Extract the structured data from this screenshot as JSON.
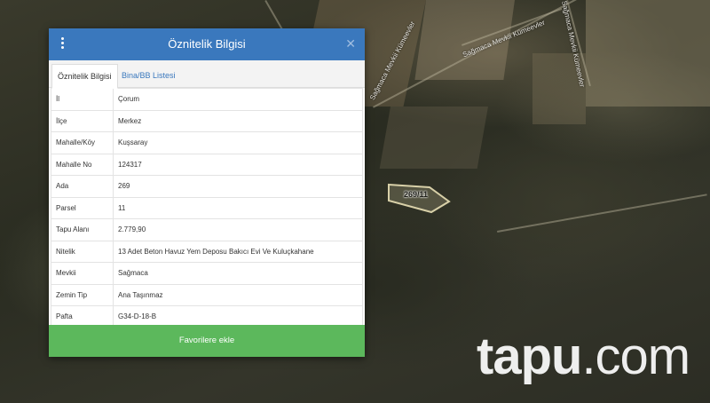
{
  "dialog": {
    "title": "Öznitelik Bilgisi",
    "tabs": [
      {
        "label": "Öznitelik Bilgisi",
        "active": true
      },
      {
        "label": "Bina/BB Listesi",
        "active": false
      }
    ],
    "rows": [
      {
        "key": "İl",
        "value": "Çorum"
      },
      {
        "key": "İlçe",
        "value": "Merkez"
      },
      {
        "key": "Mahalle/Köy",
        "value": "Kuşsaray"
      },
      {
        "key": "Mahalle No",
        "value": "124317"
      },
      {
        "key": "Ada",
        "value": "269"
      },
      {
        "key": "Parsel",
        "value": "11"
      },
      {
        "key": "Tapu Alanı",
        "value": "2.779,90"
      },
      {
        "key": "Nitelik",
        "value": "13 Adet Beton Havuz Yem Deposu Bakıcı Evi Ve Kuluçkahane"
      },
      {
        "key": "Mevkii",
        "value": "Sağmaca"
      },
      {
        "key": "Zemin Tip",
        "value": "Ana Taşınmaz"
      },
      {
        "key": "Pafta",
        "value": "G34-D-18-B"
      }
    ],
    "favorite_button": "Favorilere ekle",
    "colors": {
      "header": "#3a78bd",
      "button": "#5cb85c"
    }
  },
  "map": {
    "parcel_label": "269/11",
    "road_labels": [
      "Sağmaca Mevkii Kümeevler",
      "Sağmaca Mevkii Kümeevler",
      "Sağmaca Mevkii Kümeevler"
    ]
  },
  "watermark": {
    "brand": "tapu",
    "suffix": ".com"
  }
}
